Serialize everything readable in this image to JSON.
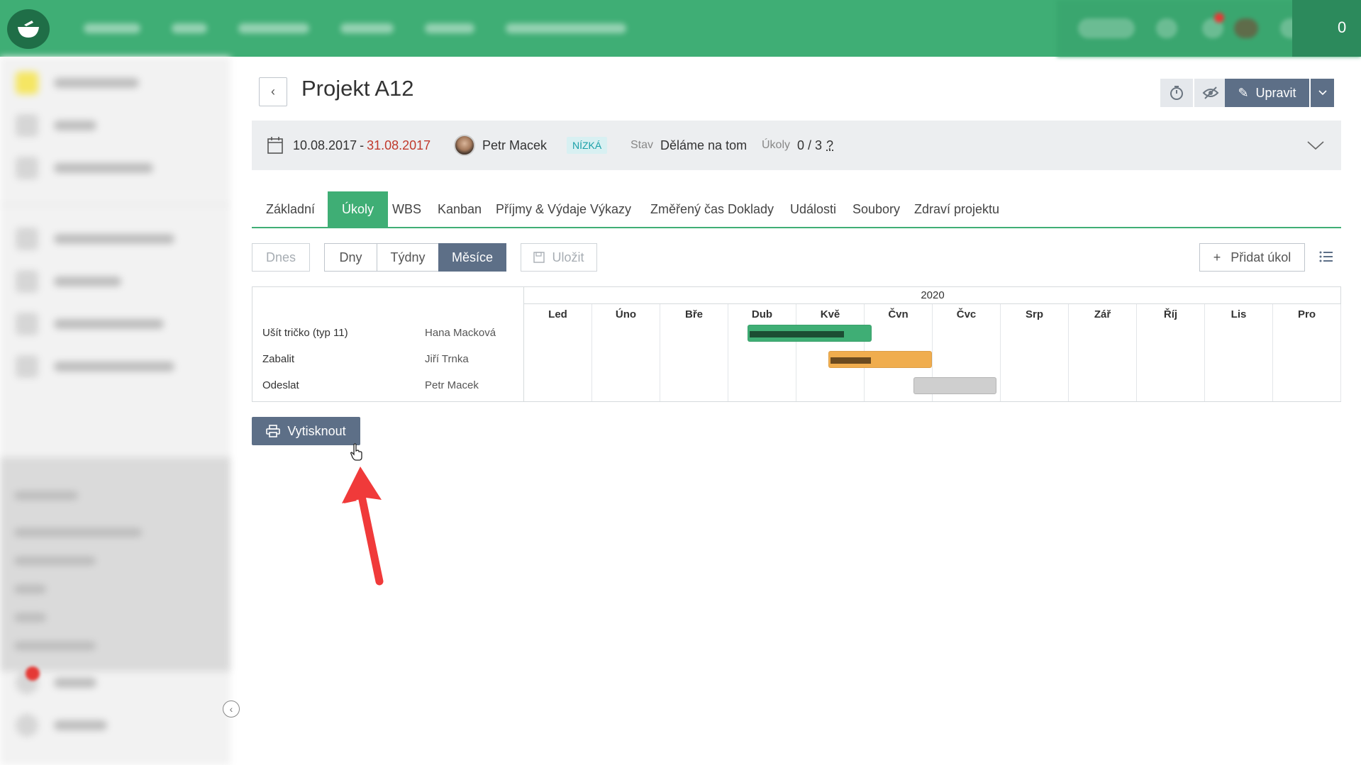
{
  "topbar": {
    "counter": "0",
    "accent": "#3fae75"
  },
  "header": {
    "title": "Projekt A12",
    "edit_label": "Upravit"
  },
  "info": {
    "date_start": "10.08.2017",
    "date_sep": "-",
    "date_end": "31.08.2017",
    "owner": "Petr Macek",
    "priority": "NÍZKÁ",
    "status_label": "Stav",
    "status_value": "Děláme na tom",
    "tasks_label": "Úkoly",
    "tasks_value": "0 / 3",
    "tasks_help": "?"
  },
  "tabs": [
    {
      "label": "Základní"
    },
    {
      "label": "Úkoly",
      "active": true
    },
    {
      "label": "WBS"
    },
    {
      "label": "Kanban"
    },
    {
      "label": "Příjmy & Výdaje"
    },
    {
      "label": "Výkazy"
    },
    {
      "label": "Změřený čas"
    },
    {
      "label": "Doklady"
    },
    {
      "label": "Události"
    },
    {
      "label": "Soubory"
    },
    {
      "label": "Zdraví projektu"
    }
  ],
  "toolbar": {
    "today": "Dnes",
    "days": "Dny",
    "weeks": "Týdny",
    "months": "Měsíce",
    "active_view": "Měsíce",
    "save": "Uložit",
    "add_task": "Přidat úkol"
  },
  "gantt": {
    "year": "2020",
    "months": [
      "Led",
      "Úno",
      "Bře",
      "Dub",
      "Kvě",
      "Čvn",
      "Čvc",
      "Srp",
      "Zář",
      "Říj",
      "Lis",
      "Pro"
    ],
    "tasks": [
      {
        "name": "Ušít tričko (typ 11)",
        "assignee": "Hana Macková",
        "start_month": 3.28,
        "end_month": 5.1,
        "progress": 0.78,
        "color": "#3fae75",
        "progress_color": "#1c4d33"
      },
      {
        "name": "Zabalit",
        "assignee": "Jiří Trnka",
        "start_month": 4.47,
        "end_month": 5.99,
        "progress": 0.4,
        "color": "#f0ad4e",
        "progress_color": "#6b4a1f"
      },
      {
        "name": "Odeslat",
        "assignee": "Petr Macek",
        "start_month": 5.72,
        "end_month": 6.94,
        "progress": 0,
        "color": "#cfcfcf",
        "progress_color": "#cfcfcf"
      }
    ]
  },
  "print": {
    "label": "Vytisknout"
  },
  "annotation": {
    "arrow_color": "#f03a3a"
  }
}
